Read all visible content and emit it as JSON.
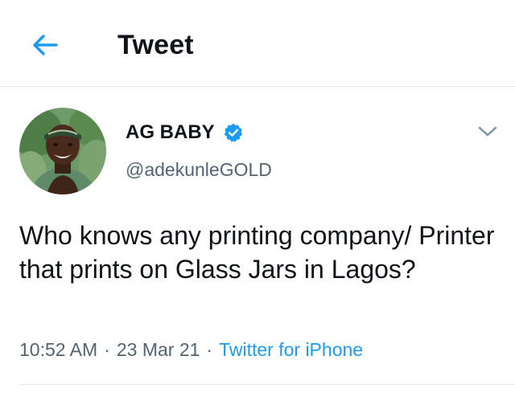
{
  "header": {
    "title": "Tweet",
    "back_icon": "arrow-left-icon"
  },
  "tweet": {
    "author": {
      "display_name": "AG BABY",
      "handle": "@adekunleGOLD",
      "verified": true
    },
    "text": "Who knows any printing company/ Printer that prints on Glass Jars in Lagos?",
    "time": "10:52 AM",
    "date": "23 Mar 21",
    "source": "Twitter for iPhone",
    "separator": "·",
    "menu_icon": "chevron-down-icon"
  },
  "colors": {
    "accent": "#1d9bf0",
    "text_primary": "#0f1419",
    "text_secondary": "#536471",
    "divider": "#e1e8ed"
  }
}
